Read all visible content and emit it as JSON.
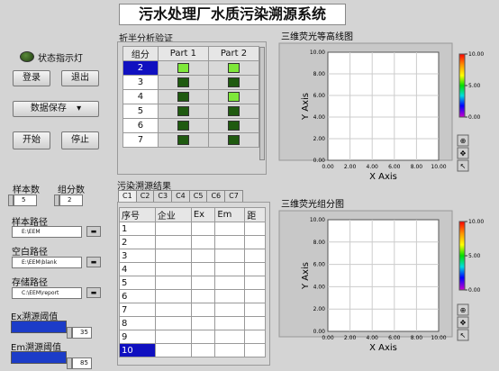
{
  "title": "污水处理厂水质污染溯源系统",
  "status_light_label": "状态指示灯",
  "buttons": {
    "login": "登录",
    "exit": "退出",
    "save": "数据保存",
    "start": "开始",
    "stop": "停止"
  },
  "inputs": {
    "sample_count_label": "样本数",
    "sample_count_value": "5",
    "group_count_label": "组分数",
    "group_count_value": "2",
    "sample_path_label": "样本路径",
    "sample_path_value": "E:\\EEM",
    "blank_path_label": "空白路径",
    "blank_path_value": "E:\\EEM\\blank",
    "store_path_label": "存储路径",
    "store_path_value": "C:\\EEM\\report",
    "ex_threshold_label": "Ex溯源阈值",
    "ex_threshold_value": "35",
    "em_threshold_label": "Em溯源阈值",
    "em_threshold_value": "85"
  },
  "colors": {
    "led_off": "#1f3d10",
    "bright_green": "#7ee83a",
    "dark_green": "#1f5a10",
    "slider_blue": "#1c3cc8",
    "index_highlight": "#1010c0"
  },
  "half_split": {
    "title": "折半分析验证",
    "headers": [
      "组分",
      "Part 1",
      "Part 2"
    ],
    "rows": [
      {
        "idx": "2",
        "p1": "bright",
        "p2": "bright"
      },
      {
        "idx": "3",
        "p1": "dark",
        "p2": "dark"
      },
      {
        "idx": "4",
        "p1": "dark",
        "p2": "bright"
      },
      {
        "idx": "5",
        "p1": "dark",
        "p2": "dark"
      },
      {
        "idx": "6",
        "p1": "dark",
        "p2": "dark"
      },
      {
        "idx": "7",
        "p1": "dark",
        "p2": "dark"
      }
    ]
  },
  "results": {
    "title": "污染溯源结果",
    "tabs": [
      "C1",
      "C2",
      "C3",
      "C4",
      "C5",
      "C6",
      "C7"
    ],
    "headers": [
      "序号",
      "企业",
      "Ex",
      "Em",
      "距"
    ],
    "rows": [
      "1",
      "2",
      "3",
      "4",
      "5",
      "6",
      "7",
      "8",
      "9",
      "10"
    ]
  },
  "chart_data": [
    {
      "type": "heatmap",
      "title": "三维荧光等高线图",
      "xlabel": "X Axis",
      "ylabel": "Y Axis",
      "xlim": [
        0,
        10
      ],
      "ylim": [
        0,
        10
      ],
      "x_ticks": [
        "0.00",
        "2.00",
        "4.00",
        "6.00",
        "8.00",
        "10.00"
      ],
      "y_ticks": [
        "0.00",
        "2.00",
        "4.00",
        "6.00",
        "8.00",
        "10.00"
      ],
      "grid": true,
      "colorbar": {
        "ticks": [
          "10.00",
          "5.00",
          "0.00"
        ],
        "range": [
          0,
          10
        ]
      }
    },
    {
      "type": "heatmap",
      "title": "三维荧光组分图",
      "xlabel": "X Axis",
      "ylabel": "Y Axis",
      "xlim": [
        0,
        10
      ],
      "ylim": [
        0,
        10
      ],
      "x_ticks": [
        "0.00",
        "2.00",
        "4.00",
        "6.00",
        "8.00",
        "10.00"
      ],
      "y_ticks": [
        "0.00",
        "2.00",
        "4.00",
        "6.00",
        "8.00",
        "10.00"
      ],
      "grid": true,
      "colorbar": {
        "ticks": [
          "10.00",
          "5.00",
          "0.00"
        ],
        "range": [
          0,
          10
        ]
      }
    }
  ]
}
